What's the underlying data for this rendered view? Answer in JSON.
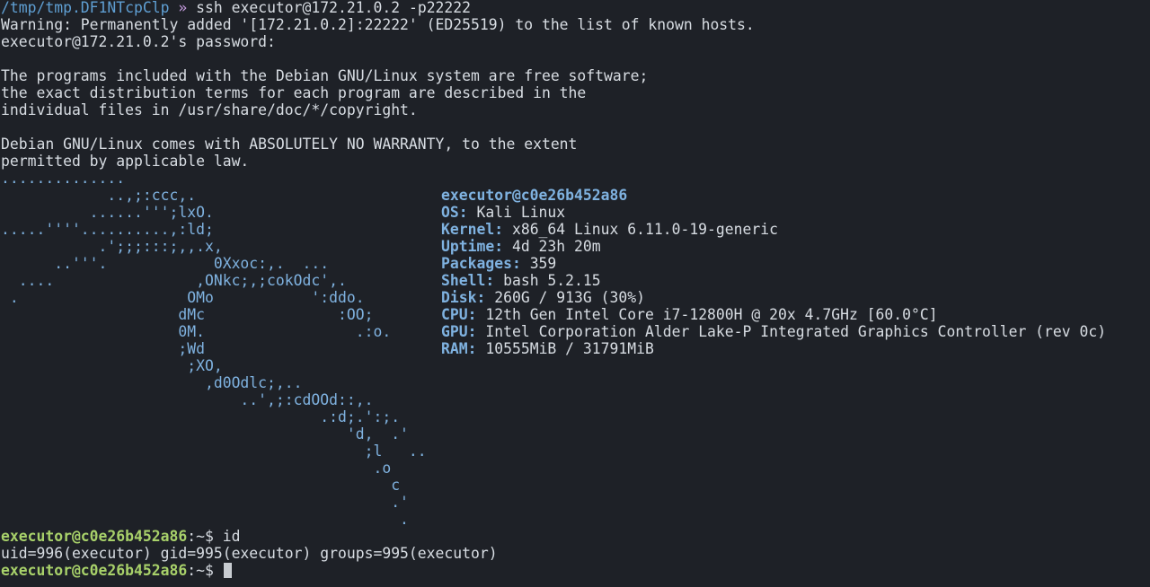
{
  "shell_prompt": {
    "path": "/tmp/tmp.DF1NTcpClp",
    "arrow": "»",
    "command": "ssh executor@172.21.0.2 -p22222"
  },
  "output_lines": [
    "Warning: Permanently added '[172.21.0.2]:22222' (ED25519) to the list of known hosts.",
    "executor@172.21.0.2's password:",
    "",
    "The programs included with the Debian GNU/Linux system are free software;",
    "the exact distribution terms for each program are described in the",
    "individual files in /usr/share/doc/*/copyright.",
    "",
    "Debian GNU/Linux comes with ABSOLUTELY NO WARRANTY, to the extent",
    "permitted by applicable law."
  ],
  "logo_lines": [
    "..............",
    "            ..,;:ccc,.",
    "          ......''';lxO.",
    ".....''''..........,:ld;",
    "           .';;;:::;,,.x,",
    "      ..'''.            0Xxoc:,.  ...",
    "  ....                ,ONkc;,;cokOdc',.",
    " .                   OMo           ':ddo.",
    "                    dMc               :OO;",
    "                    0M.                 .:o.",
    "                    ;Wd",
    "                     ;XO,",
    "                       ,d0Odlc;,..",
    "                           ..',;:cdOOd::,.",
    "                                    .:d;.':;.",
    "                                       'd,  .'",
    "                                         ;l   ..",
    "                                          .o",
    "                                            c",
    "                                            .'",
    "                                             ."
  ],
  "system_info": {
    "title": "executor@c0e26b452a86",
    "rows": [
      {
        "key": "OS:",
        "value": "Kali Linux"
      },
      {
        "key": "Kernel:",
        "value": "x86_64 Linux 6.11.0-19-generic"
      },
      {
        "key": "Uptime:",
        "value": "4d 23h 20m"
      },
      {
        "key": "Packages:",
        "value": "359"
      },
      {
        "key": "Shell:",
        "value": "bash 5.2.15"
      },
      {
        "key": "Disk:",
        "value": "260G / 913G (30%)"
      },
      {
        "key": "CPU:",
        "value": "12th Gen Intel Core i7-12800H @ 20x 4.7GHz [60.0°C]"
      },
      {
        "key": "GPU:",
        "value": "Intel Corporation Alder Lake-P Integrated Graphics Controller (rev 0c)"
      },
      {
        "key": "RAM:",
        "value": "10555MiB / 31791MiB"
      }
    ]
  },
  "session": {
    "prompt_user": "executor@c0e26b452a86",
    "prompt_suffix": ":~$",
    "command1": "id",
    "id_output": "uid=996(executor) gid=995(executor) groups=995(executor)",
    "command2": ""
  },
  "colors": {
    "background": "#1e2127",
    "text": "#d8dde3",
    "path": "#5f9fd3",
    "logo": "#7fb2e0",
    "prompt_user": "#a8d16a"
  }
}
